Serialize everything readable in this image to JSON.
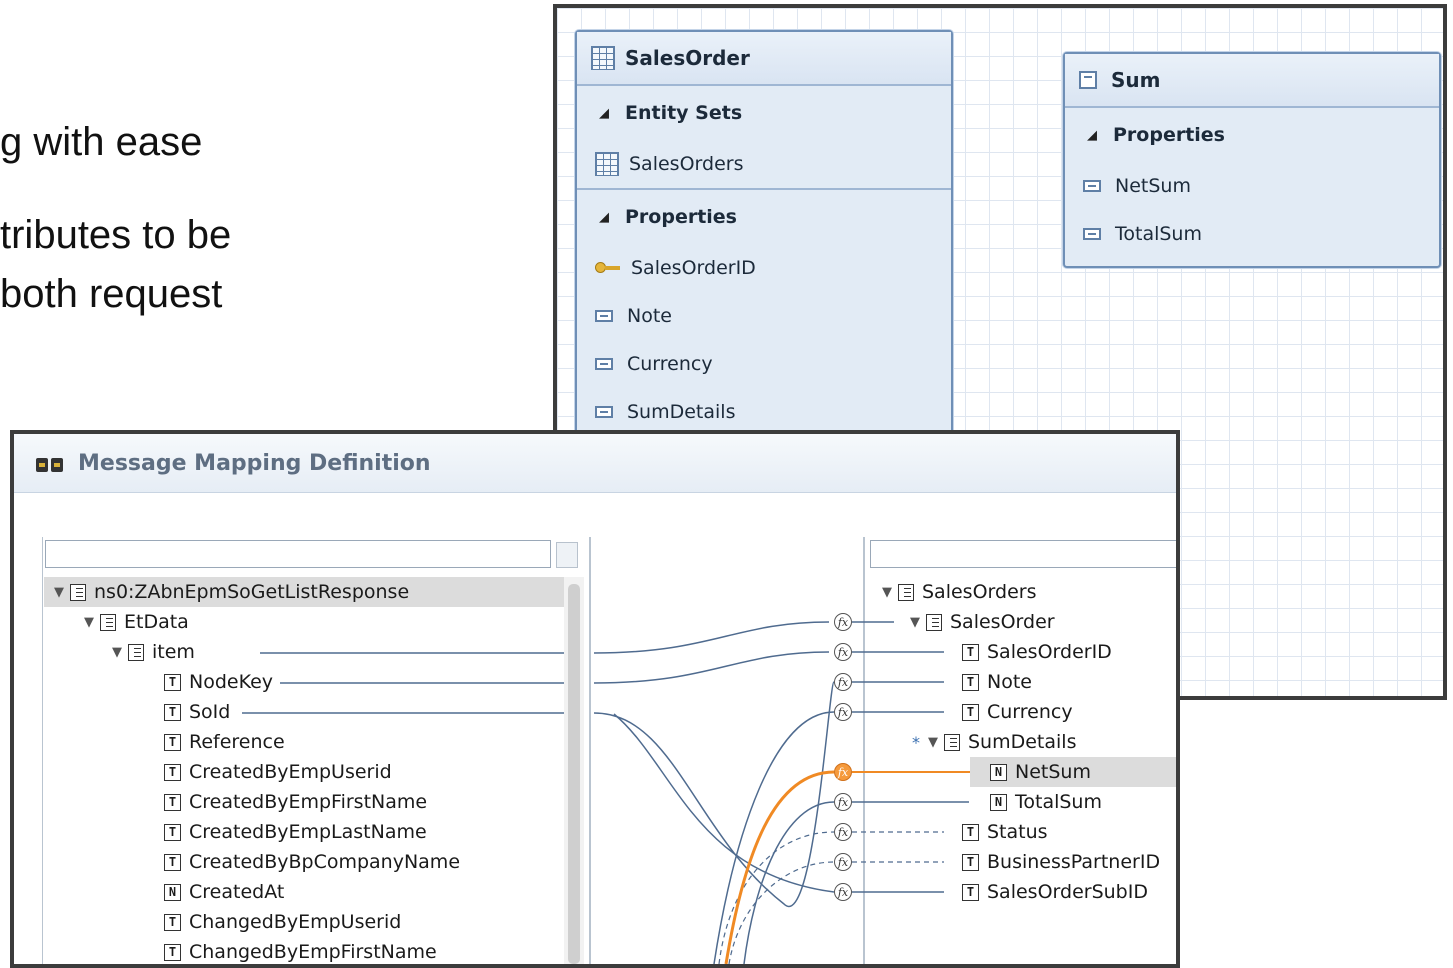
{
  "slide": {
    "line1": "g with ease",
    "line2": "tributes to be",
    "line3": "both request"
  },
  "model": {
    "sales_order": {
      "title": "SalesOrder",
      "section_entity_sets": "Entity Sets",
      "entity_set_item": "SalesOrders",
      "section_properties": "Properties",
      "properties": [
        "SalesOrderID",
        "Note",
        "Currency",
        "SumDetails"
      ]
    },
    "sum": {
      "title": "Sum",
      "section_properties": "Properties",
      "properties": [
        "NetSum",
        "TotalSum"
      ]
    }
  },
  "mapping": {
    "title": "Message Mapping Definition",
    "source_filter_value": "",
    "target_filter_value": "",
    "source_tree": [
      {
        "label": "ns0:ZAbnEpmSoGetListResponse",
        "type": "E"
      },
      {
        "label": "EtData",
        "type": "E"
      },
      {
        "label": "item",
        "type": "E"
      },
      {
        "label": "NodeKey",
        "type": "T"
      },
      {
        "label": "SoId",
        "type": "T"
      },
      {
        "label": "Reference",
        "type": "T"
      },
      {
        "label": "CreatedByEmpUserid",
        "type": "T"
      },
      {
        "label": "CreatedByEmpFirstName",
        "type": "T"
      },
      {
        "label": "CreatedByEmpLastName",
        "type": "T"
      },
      {
        "label": "CreatedByBpCompanyName",
        "type": "T"
      },
      {
        "label": "CreatedAt",
        "type": "N"
      },
      {
        "label": "ChangedByEmpUserid",
        "type": "T"
      },
      {
        "label": "ChangedByEmpFirstName",
        "type": "T"
      }
    ],
    "target_tree": [
      {
        "label": "SalesOrders",
        "type": "E"
      },
      {
        "label": "SalesOrder",
        "type": "E"
      },
      {
        "label": "SalesOrderID",
        "type": "T"
      },
      {
        "label": "Note",
        "type": "T"
      },
      {
        "label": "Currency",
        "type": "T"
      },
      {
        "label": "SumDetails",
        "type": "E"
      },
      {
        "label": "NetSum",
        "type": "N"
      },
      {
        "label": "TotalSum",
        "type": "N"
      },
      {
        "label": "Status",
        "type": "T"
      },
      {
        "label": "BusinessPartnerID",
        "type": "T"
      },
      {
        "label": "SalesOrderSubID",
        "type": "T"
      }
    ],
    "function_glyph": "fx",
    "occurrence_marker": "*",
    "active_color": "#f08a24"
  }
}
